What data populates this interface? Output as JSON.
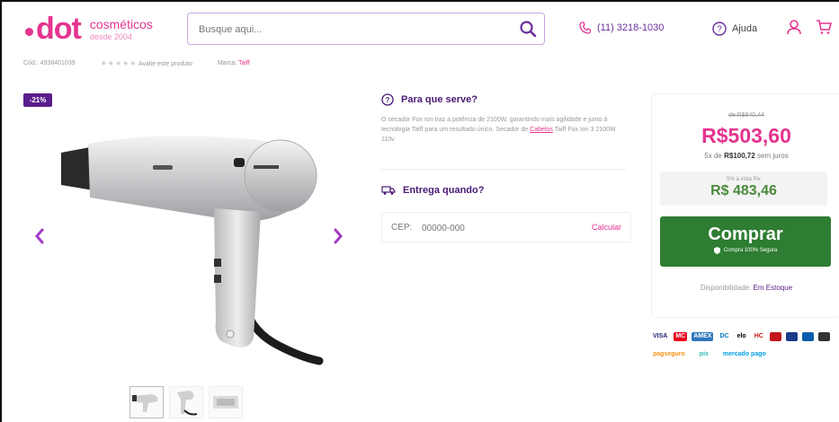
{
  "header": {
    "logo_word": "dot",
    "logo_sub": "cosméticos",
    "logo_tagline": "desde 2004",
    "search_placeholder": "Busque aqui...",
    "phone": "(11) 3218-1030",
    "help": "Ajuda"
  },
  "meta": {
    "sku": "Cód.: 4938401039",
    "stars": "★★★★★",
    "rate": "Avalie este produto",
    "brand_label": "Marca:",
    "brand": "Taiff"
  },
  "gallery": {
    "discount_badge": "-21%",
    "thumbnails": [
      "thumb-1",
      "thumb-2",
      "thumb-3"
    ]
  },
  "info": {
    "title": "Para que serve?",
    "text": "O secador Fox Ion traz a potência de 2100W, garantindo mais agilidade e junto à tecnologia Taiff para um resultado único. Secador de",
    "text_link": "Cabelos",
    "text_tail": "Taiff Fox Ion 3 2100W 110v",
    "ship_title": "Entrega quando?",
    "cep_label": "CEP:",
    "cep_placeholder": "00000-000",
    "cep_button": "Calcular"
  },
  "price": {
    "old": "de R$640,44",
    "current": "R$503,60",
    "installments_prefix": "5x de",
    "installments_value": "R$100,72",
    "installments_suffix": "sem juros",
    "pix_label": "5% à vista Pix",
    "pix_price": "R$ 483,46",
    "buy": "Comprar",
    "buy_sub": "Compra 100% Segura",
    "avail_label": "Disponibilidade:",
    "avail_value": "Em Estoque"
  },
  "payments": {
    "row1": [
      "VISA",
      "MC",
      "AMEX",
      "DC",
      "elo",
      "HC",
      "B1",
      "B2",
      "B3",
      "B4"
    ],
    "row2": [
      "pagseguro",
      "pix",
      "mercado pago"
    ]
  },
  "colors": {
    "brand_pink": "#e4348f",
    "brand_purple": "#5a1d8c",
    "buy_green": "#2e7d32"
  }
}
